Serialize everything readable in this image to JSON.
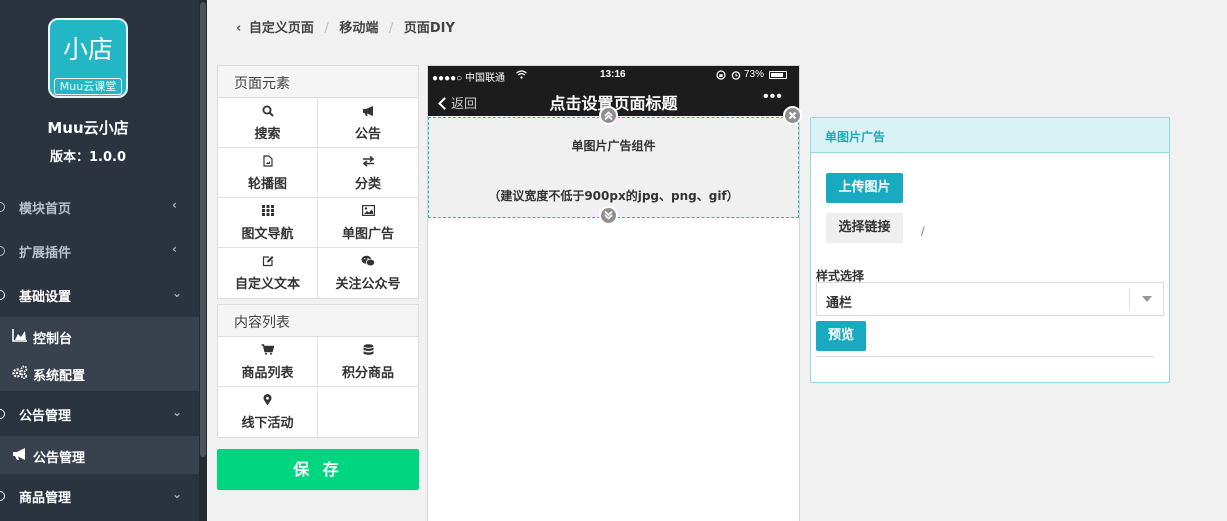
{
  "sidebar": {
    "logo": {
      "main": "小店",
      "sub": "Muu云课堂"
    },
    "shop_name": "Muu云小店",
    "version": "版本：1.0.0",
    "menu": [
      {
        "label": "模块首页"
      },
      {
        "label": "扩展插件"
      },
      {
        "label": "基础设置"
      },
      {
        "label": "公告管理"
      },
      {
        "label": "商品管理"
      }
    ],
    "sub_items": [
      {
        "label": "控制台",
        "icon": "area-chart-icon"
      },
      {
        "label": "系统配置",
        "icon": "cogs-icon"
      },
      {
        "label": "公告管理",
        "icon": "bullhorn-icon"
      }
    ]
  },
  "breadcrumb": [
    "自定义页面",
    "移动端",
    "页面DIY"
  ],
  "elements_panel": {
    "title": "页面元素",
    "items": [
      {
        "label": "搜索",
        "icon": "search-icon"
      },
      {
        "label": "公告",
        "icon": "bullhorn-icon"
      },
      {
        "label": "轮播图",
        "icon": "file-image-icon"
      },
      {
        "label": "分类",
        "icon": "exchange-icon"
      },
      {
        "label": "图文导航",
        "icon": "grid-icon"
      },
      {
        "label": "单图广告",
        "icon": "picture-icon"
      },
      {
        "label": "自定义文本",
        "icon": "edit-icon"
      },
      {
        "label": "关注公众号",
        "icon": "wechat-icon"
      }
    ]
  },
  "content_panel": {
    "title": "内容列表",
    "items": [
      {
        "label": "商品列表",
        "icon": "cart-icon"
      },
      {
        "label": "积分商品",
        "icon": "database-icon"
      },
      {
        "label": "线下活动",
        "icon": "map-marker-icon"
      }
    ]
  },
  "save_label": "保 存",
  "phone": {
    "carrier": "●●●●○ 中国联通",
    "time": "13:16",
    "battery": "73%",
    "back_label": "返回",
    "title": "点击设置页面标题",
    "more": "•••",
    "ad_title": "单图片广告组件",
    "ad_hint": "（建议宽度不低于900px的jpg、png、gif）"
  },
  "editor": {
    "title": "单图片广告",
    "upload_label": "上传图片",
    "link_label": "选择链接",
    "link_value": "/",
    "style_label": "样式选择",
    "style_value": "通栏",
    "preview_label": "预览"
  },
  "colors": {
    "sidebar_bg": "#2b333e",
    "accent": "#18aac0",
    "save_green": "#00d67f",
    "logo_teal": "#23b7c6"
  }
}
